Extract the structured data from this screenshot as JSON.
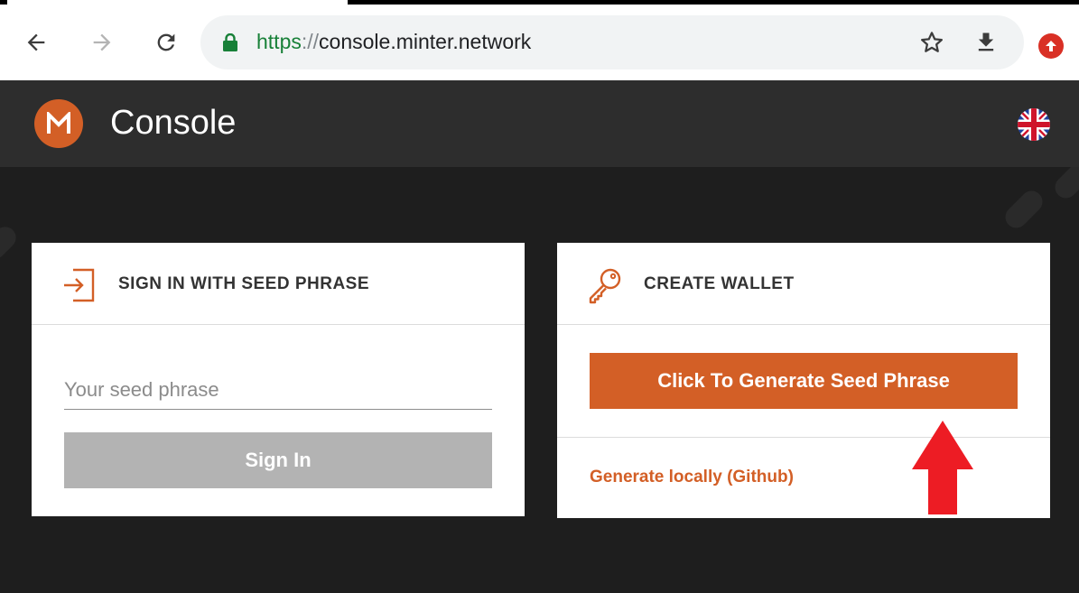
{
  "browser": {
    "url_scheme": "https",
    "url_separator": "://",
    "url_host": "console.minter.network",
    "icons": {
      "back": "back-arrow-icon",
      "forward": "forward-arrow-icon",
      "reload": "reload-icon",
      "lock": "lock-icon",
      "bookmark": "star-icon",
      "download": "download-icon",
      "update": "update-icon"
    }
  },
  "app": {
    "logo_letter": "M",
    "title": "Console",
    "language_flag": "uk-flag-icon"
  },
  "signin_card": {
    "title": "SIGN IN WITH SEED PHRASE",
    "icon": "sign-in-icon",
    "input_placeholder": "Your seed phrase",
    "input_value": "",
    "button_label": "Sign In"
  },
  "create_card": {
    "title": "CREATE WALLET",
    "icon": "key-icon",
    "button_label": "Click To Generate Seed Phrase",
    "link_label": "Generate locally (Github)"
  },
  "annotation": {
    "arrow": "red-up-arrow-icon"
  },
  "colors": {
    "accent": "#d35f26",
    "header_bg": "#2d2d2d",
    "main_bg": "#1e1e1e",
    "disabled_button": "#b3b3b3",
    "annotation_red": "#ed1c24"
  }
}
